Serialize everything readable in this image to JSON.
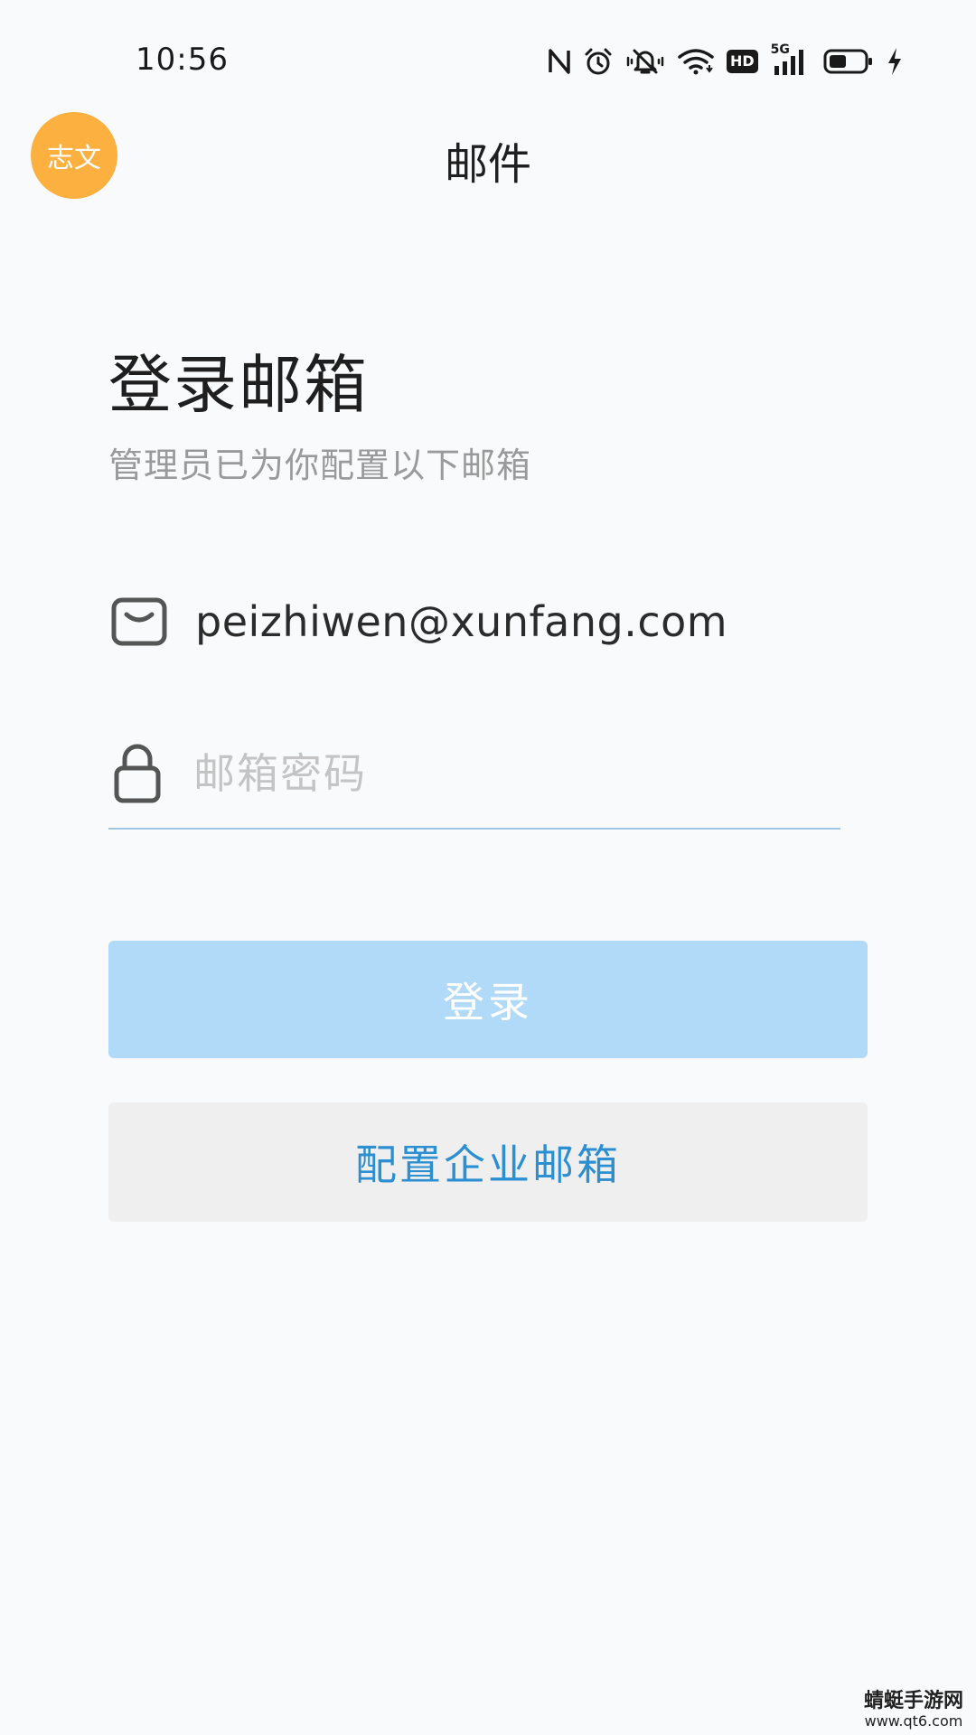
{
  "status_bar": {
    "time": "10:56",
    "icons": [
      "nfc-icon",
      "alarm-icon",
      "vibrate-icon",
      "wifi-icon",
      "hd-icon",
      "signal-5g-icon",
      "battery-icon",
      "charging-icon"
    ],
    "hd_label": "HD",
    "network_label": "5G"
  },
  "header": {
    "avatar_text": "志文",
    "avatar_color": "#fbb040",
    "title": "邮件"
  },
  "login": {
    "title": "登录邮箱",
    "subtitle": "管理员已为你配置以下邮箱",
    "email": "peizhiwen@xunfang.com",
    "password_placeholder": "邮箱密码",
    "password_value": "",
    "login_button": "登录",
    "config_button": "配置企业邮箱"
  },
  "colors": {
    "login_button_bg": "#b1d9f8",
    "config_button_text": "#2b8fd1",
    "input_underline": "#9fc7e4"
  },
  "watermark": {
    "name": "蜻蜓手游网",
    "url": "www.qt6.com"
  }
}
